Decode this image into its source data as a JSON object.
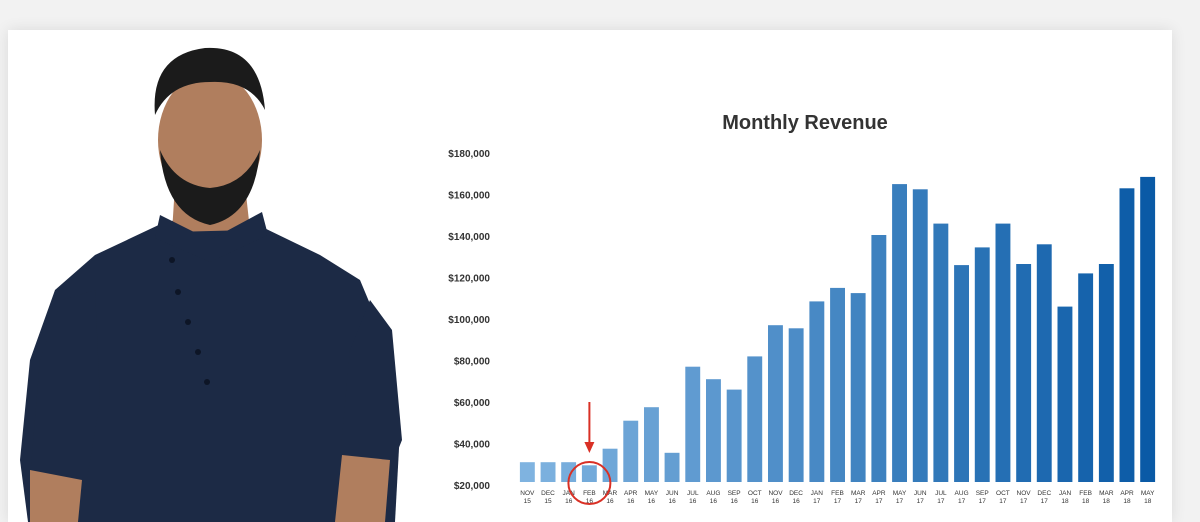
{
  "chart_data": {
    "type": "bar",
    "title": "Monthly Revenue",
    "xlabel": "",
    "ylabel": "",
    "ylim": [
      20000,
      180000
    ],
    "yticks": [
      "$20,000",
      "$40,000",
      "$60,000",
      "$80,000",
      "$100,000",
      "$120,000",
      "$140,000",
      "$160,000",
      "$180,000"
    ],
    "ytick_values": [
      20000,
      40000,
      60000,
      80000,
      100000,
      120000,
      140000,
      160000,
      180000
    ],
    "grid": false,
    "categories": [
      [
        "NOV",
        "15"
      ],
      [
        "DEC",
        "15"
      ],
      [
        "JAN",
        "16"
      ],
      [
        "FEB",
        "16"
      ],
      [
        "MAR",
        "16"
      ],
      [
        "APR",
        "16"
      ],
      [
        "MAY",
        "16"
      ],
      [
        "JUN",
        "16"
      ],
      [
        "JUL",
        "16"
      ],
      [
        "AUG",
        "16"
      ],
      [
        "SEP",
        "16"
      ],
      [
        "OCT",
        "16"
      ],
      [
        "NOV",
        "16"
      ],
      [
        "DEC",
        "16"
      ],
      [
        "JAN",
        "17"
      ],
      [
        "FEB",
        "17"
      ],
      [
        "MAR",
        "17"
      ],
      [
        "APR",
        "17"
      ],
      [
        "MAY",
        "17"
      ],
      [
        "JUN",
        "17"
      ],
      [
        "JUL",
        "17"
      ],
      [
        "AUG",
        "17"
      ],
      [
        "SEP",
        "17"
      ],
      [
        "OCT",
        "17"
      ],
      [
        "NOV",
        "17"
      ],
      [
        "DEC",
        "17"
      ],
      [
        "JAN",
        "18"
      ],
      [
        "FEB",
        "18"
      ],
      [
        "MAR",
        "18"
      ],
      [
        "APR",
        "18"
      ],
      [
        "MAY",
        "18"
      ]
    ],
    "values": [
      31000,
      31000,
      31000,
      29500,
      37500,
      51000,
      57500,
      35500,
      77000,
      71000,
      66000,
      82000,
      97000,
      95500,
      108500,
      115000,
      112500,
      140500,
      165000,
      162500,
      146000,
      126000,
      134500,
      146000,
      126500,
      136000,
      106000,
      122000,
      126500,
      163000,
      168500
    ],
    "colors": {
      "light": "#7fb3e0",
      "dark": "#0a5aa6",
      "annotation": "#d93025",
      "text": "#333333"
    },
    "annotation": {
      "type": "circle-with-arrow",
      "target_category_index": 3
    }
  },
  "image": {
    "subject": "person",
    "colors": {
      "shirt": "#1c2a45",
      "skin": "#b07e5e",
      "hair": "#1b1b1b"
    }
  }
}
